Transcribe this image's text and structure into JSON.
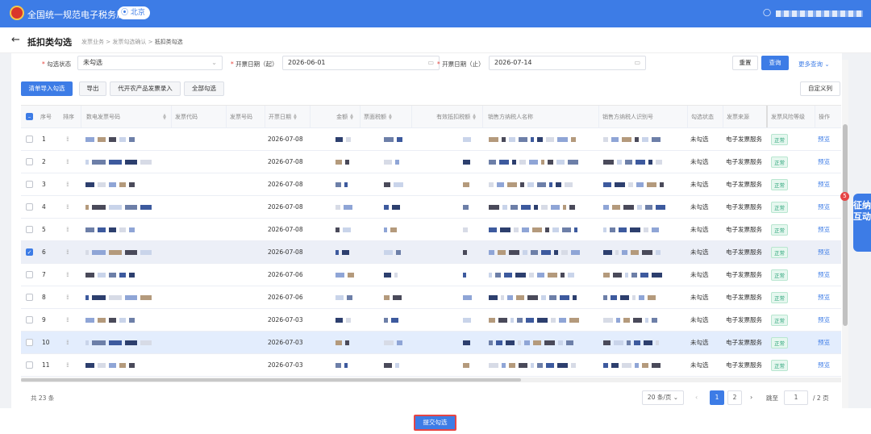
{
  "header": {
    "brand": "全国统一规范电子税务局",
    "location": "北京",
    "user_icon": "user-icon"
  },
  "titlebar": {
    "title": "抵扣类勾选",
    "breadcrumb": [
      "发票业务",
      "发票勾选确认",
      "抵扣类勾选"
    ],
    "separator": ">"
  },
  "filters": {
    "status_label": "勾选状态",
    "status_value": "未勾选",
    "date_start_label": "开票日期（起）",
    "date_start_value": "2026-06-01",
    "date_end_label": "开票日期（止）",
    "date_end_value": "2026-07-14",
    "reset": "重置",
    "query": "查询",
    "more_query": "更多查询",
    "required_mark": "*"
  },
  "actions": {
    "import_select": "清单导入勾选",
    "export": "导出",
    "agri_entry": "代开农产品发票录入",
    "select_all": "全部勾选",
    "custom_columns": "自定义列"
  },
  "table": {
    "headers": {
      "index": "序号",
      "sort": "排序",
      "digital_no": "数电发票号码",
      "invoice_code": "发票代码",
      "invoice_no": "发票号码",
      "issue_date": "开票日期",
      "amount": "金额",
      "tax": "票面税额",
      "deductible_tax": "有效抵扣税额",
      "seller_name": "销售方纳税人名称",
      "seller_id": "销售方纳税人识别号",
      "status": "勾选状态",
      "source": "发票来源",
      "risk": "发票风险等级",
      "op": "操作"
    },
    "rows": [
      {
        "index": "1",
        "date": "2026-07-08",
        "status": "未勾选",
        "source": "电子发票服务",
        "risk": "正常",
        "op": "预览",
        "checked": false
      },
      {
        "index": "2",
        "date": "2026-07-08",
        "status": "未勾选",
        "source": "电子发票服务",
        "risk": "正常",
        "op": "预览",
        "checked": false
      },
      {
        "index": "3",
        "date": "2026-07-08",
        "status": "未勾选",
        "source": "电子发票服务",
        "risk": "正常",
        "op": "预览",
        "checked": false
      },
      {
        "index": "4",
        "date": "2026-07-08",
        "status": "未勾选",
        "source": "电子发票服务",
        "risk": "正常",
        "op": "预览",
        "checked": false
      },
      {
        "index": "5",
        "date": "2026-07-08",
        "status": "未勾选",
        "source": "电子发票服务",
        "risk": "正常",
        "op": "预览",
        "checked": false
      },
      {
        "index": "6",
        "date": "2026-07-08",
        "status": "未勾选",
        "source": "电子发票服务",
        "risk": "正常",
        "op": "预览",
        "checked": true
      },
      {
        "index": "7",
        "date": "2026-07-06",
        "status": "未勾选",
        "source": "电子发票服务",
        "risk": "正常",
        "op": "预览",
        "checked": false
      },
      {
        "index": "8",
        "date": "2026-07-06",
        "status": "未勾选",
        "source": "电子发票服务",
        "risk": "正常",
        "op": "预览",
        "checked": false
      },
      {
        "index": "9",
        "date": "2026-07-03",
        "status": "未勾选",
        "source": "电子发票服务",
        "risk": "正常",
        "op": "预览",
        "checked": false
      },
      {
        "index": "10",
        "date": "2026-07-03",
        "status": "未勾选",
        "source": "电子发票服务",
        "risk": "正常",
        "op": "预览",
        "checked": false
      },
      {
        "index": "11",
        "date": "2026-07-03",
        "status": "未勾选",
        "source": "电子发票服务",
        "risk": "正常",
        "op": "预览",
        "checked": false
      }
    ]
  },
  "pagination": {
    "total": "共 23 条",
    "page_size": "20 条/页",
    "pages": [
      "1",
      "2"
    ],
    "current_page": "1",
    "jump_label": "跳至",
    "jump_value": "1",
    "page_count": "/ 2 页"
  },
  "footer": {
    "submit": "提交勾选"
  },
  "float_tab": {
    "label": "征纳互动",
    "badge": "5"
  },
  "colors": {
    "accent": "#3d7ce6",
    "risk_ok": "#2ba47a",
    "highlight_border": "#e64545"
  }
}
